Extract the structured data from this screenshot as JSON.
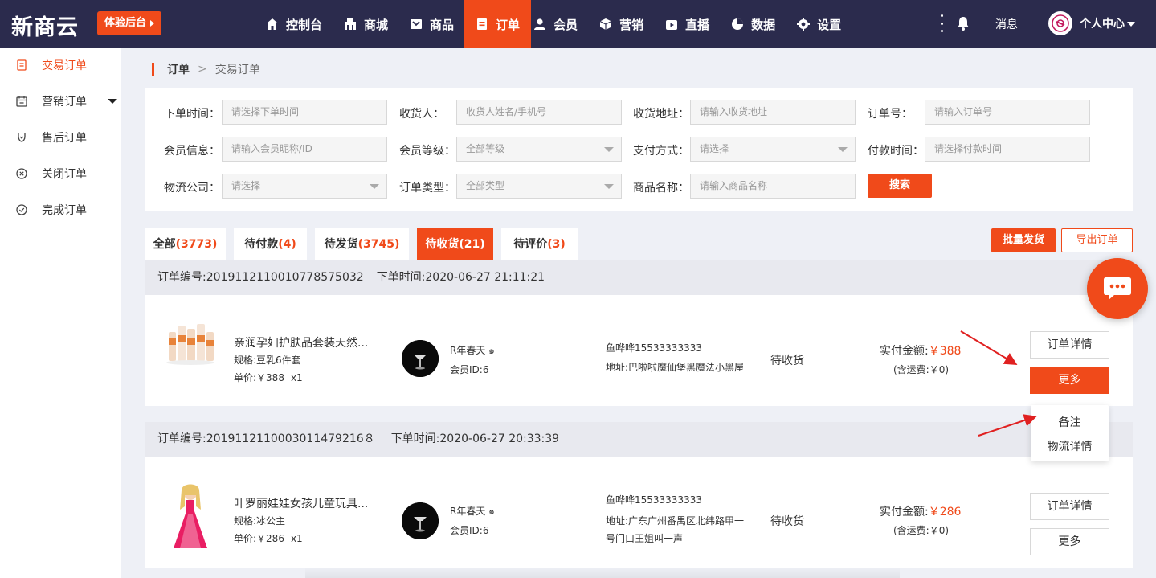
{
  "topbar": {
    "logo": "新商云",
    "trial_button": "体验后台",
    "nav": [
      {
        "label": "控制台",
        "icon": "home-icon"
      },
      {
        "label": "商城",
        "icon": "store-icon"
      },
      {
        "label": "商品",
        "icon": "goods-icon"
      },
      {
        "label": "订单",
        "icon": "order-icon",
        "active": true
      },
      {
        "label": "会员",
        "icon": "member-icon"
      },
      {
        "label": "营销",
        "icon": "marketing-icon"
      },
      {
        "label": "直播",
        "icon": "live-icon"
      },
      {
        "label": "数据",
        "icon": "data-icon"
      },
      {
        "label": "设置",
        "icon": "settings-icon"
      }
    ],
    "messages": "消息",
    "user_center": "个人中心"
  },
  "sidebar": {
    "items": [
      {
        "label": "交易订单",
        "icon": "document-icon",
        "active": true
      },
      {
        "label": "营销订单",
        "icon": "calendar-icon",
        "has_submenu": true
      },
      {
        "label": "售后订单",
        "icon": "aftersale-icon"
      },
      {
        "label": "关闭订单",
        "icon": "close-circle-icon"
      },
      {
        "label": "完成订单",
        "icon": "check-circle-icon"
      }
    ]
  },
  "breadcrumb": {
    "parent": "订单",
    "separator": ">",
    "current": "交易订单"
  },
  "filters": {
    "order_time": {
      "label": "下单时间：",
      "placeholder": "请选择下单时间"
    },
    "receiver": {
      "label": "收货人：",
      "placeholder": "收货人姓名/手机号"
    },
    "address": {
      "label": "收货地址：",
      "placeholder": "请输入收货地址"
    },
    "order_no": {
      "label": "订单号：",
      "placeholder": "请输入订单号"
    },
    "member_info": {
      "label": "会员信息：",
      "placeholder": "请输入会员昵称/ID"
    },
    "member_level": {
      "label": "会员等级：",
      "value": "全部等级"
    },
    "pay_method": {
      "label": "支付方式：",
      "value": "请选择"
    },
    "pay_time": {
      "label": "付款时间：",
      "placeholder": "请选择付款时间"
    },
    "logistics": {
      "label": "物流公司：",
      "value": "请选择"
    },
    "order_type": {
      "label": "订单类型：",
      "value": "全部类型"
    },
    "product_name": {
      "label": "商品名称：",
      "placeholder": "请输入商品名称"
    },
    "search_button": "搜索"
  },
  "tabs": [
    {
      "label": "全部",
      "count": "(3773)"
    },
    {
      "label": "待付款",
      "count": "(4)"
    },
    {
      "label": "待发货",
      "count": "(3745)"
    },
    {
      "label": "待收货",
      "count": "(21)",
      "active": true
    },
    {
      "label": "待评价",
      "count": "(3)"
    }
  ],
  "actions": {
    "batch_ship": "批量发货",
    "export": "导出订单"
  },
  "orders": [
    {
      "order_no": "订单编号:2019112110010778575032",
      "order_time": "下单时间:2020-06-27 21:11:21",
      "product_name": "亲润孕妇护肤品套装天然...",
      "spec": "规格:豆乳6件套",
      "unit_price": "单价:￥388",
      "qty": "x1",
      "user_name": "R年春天 ๑",
      "member_id": "会员ID:6",
      "receiver": "鱼哗哗15533333333",
      "address": "地址:巴啦啦魔仙堡黑魔法小黑屋",
      "address_line2": "",
      "status": "待收货",
      "paid_label": "实付金额:",
      "paid_amount": "￥388",
      "shipping": "(含运费:￥0)",
      "detail_button": "订单详情",
      "more_button": "更多"
    },
    {
      "order_no": "订单编号:2019112110003011479216８",
      "order_time": "下单时间:2020-06-27 20:33:39",
      "product_name": "叶罗丽娃娃女孩儿童玩具...",
      "spec": "规格:冰公主",
      "unit_price": "单价:￥286",
      "qty": "x1",
      "user_name": "R年春天 ๑",
      "member_id": "会员ID:6",
      "receiver": "鱼哗哗15533333333",
      "address": "地址:广东广州番禺区北纬路甲一",
      "address_line2": "号门口王姐叫一声",
      "status": "待收货",
      "paid_label": "实付金额:",
      "paid_amount": "￥286",
      "shipping": "(含运费:￥0)",
      "detail_button": "订单详情",
      "more_button": "更多"
    }
  ],
  "more_menu": {
    "remark": "备注",
    "logistics_detail": "物流详情"
  },
  "colors": {
    "brand": "#f04a1a",
    "topbar": "#2b2b4d",
    "annotation_arrow": "#e02020"
  }
}
